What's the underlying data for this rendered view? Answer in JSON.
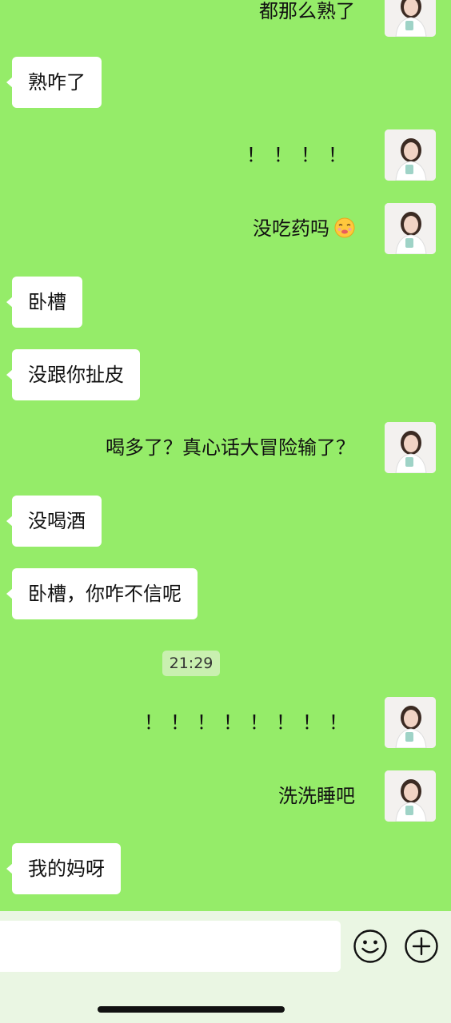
{
  "chat": {
    "messages": [
      {
        "side": "right",
        "text": "都那么熟了"
      },
      {
        "side": "left",
        "text": "熟咋了"
      },
      {
        "side": "right",
        "text": "！！！！"
      },
      {
        "side": "right",
        "text": "没吃药吗",
        "emoji": "sick-face-emoji"
      },
      {
        "side": "left",
        "text": "卧槽"
      },
      {
        "side": "left",
        "text": "没跟你扯皮"
      },
      {
        "side": "right",
        "text": "喝多了？真心话大冒险输了？"
      },
      {
        "side": "left",
        "text": "没喝酒"
      },
      {
        "side": "left",
        "text": "卧槽，你咋不信呢"
      },
      {
        "side": "right",
        "text": "！！！！！！！！"
      },
      {
        "side": "right",
        "text": "洗洗睡吧"
      },
      {
        "side": "left",
        "text": "我的妈呀"
      }
    ],
    "timestamp": "21:29"
  },
  "input_bar": {
    "input_value": "",
    "emoji_icon": "smiley-icon",
    "more_icon": "plus-circle-icon"
  },
  "colors": {
    "chat_background": "#95EC69",
    "bubble_left": "#FFFFFF",
    "input_bar_background": "#EAF6E3"
  }
}
